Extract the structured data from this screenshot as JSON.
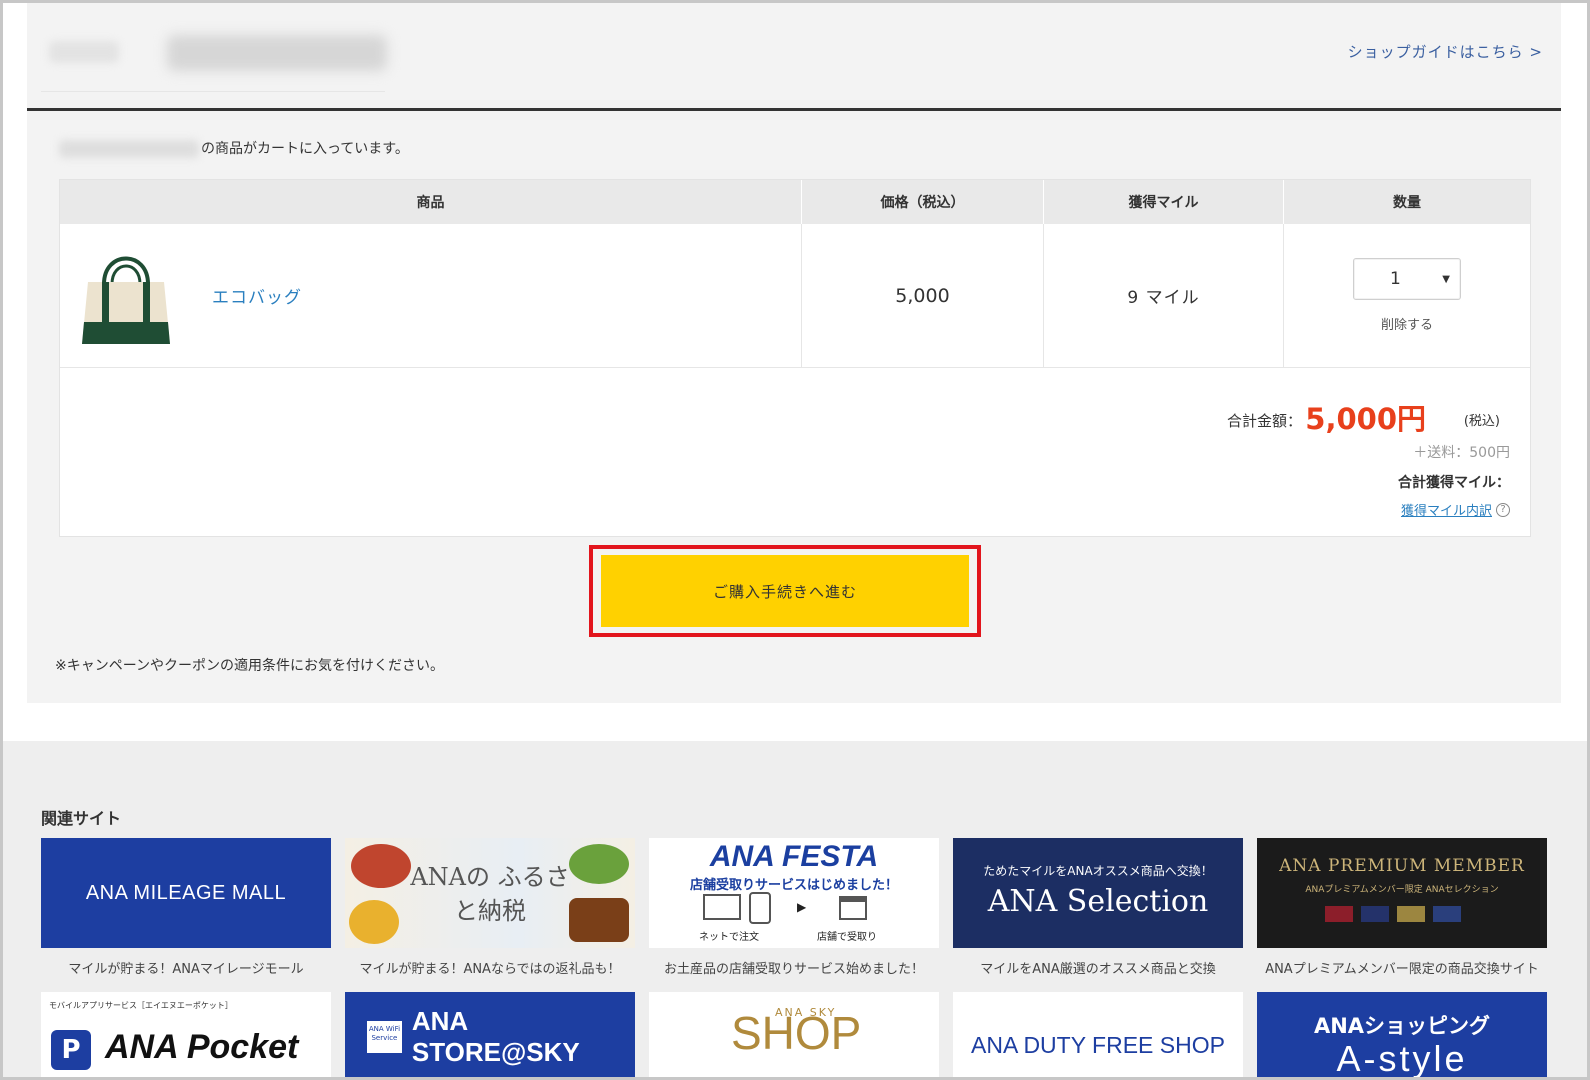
{
  "header": {
    "shop_guide_link": "ショップガイドはこちら >"
  },
  "cart": {
    "message_suffix": "の商品がカートに入っています。",
    "columns": [
      "商品",
      "価格（税込）",
      "獲得マイル",
      "数量"
    ],
    "items": [
      {
        "name": "エコバッグ",
        "price": "5,000",
        "miles": "9 マイル",
        "quantity": "1",
        "delete_label": "削除する"
      }
    ],
    "totals": {
      "label": "合計金額：",
      "value": "5,000円",
      "tax": "(税込)",
      "shipping": "＋送料：500円",
      "miles_label": "合計獲得マイル：",
      "miles_detail": "獲得マイル内訳"
    },
    "checkout_button": "ご購入手続きへ進む",
    "note": "※キャンペーンやクーポンの適用条件にお気を付けください。"
  },
  "related": {
    "title": "関連サイト",
    "sites": [
      {
        "banner": "ANA MILEAGE MALL",
        "caption": "マイルが貯まる！ANAマイレージモール"
      },
      {
        "banner": "ANAの ふるさと納税",
        "caption": "マイルが貯まる！ANAならではの返礼品も！"
      },
      {
        "banner": "ANA FESTA",
        "banner_sub": "店舗受取りサービスはじめました！",
        "banner_l1": "ネットで注文",
        "banner_l2": "店舗で受取り",
        "caption": "お土産品の店舗受取りサービス始めました！"
      },
      {
        "banner": "ANA Selection",
        "banner_sub": "ためたマイルをANAオススメ商品へ交換！",
        "caption": "マイルをANA厳選のオススメ商品と交換"
      },
      {
        "banner": "ANA PREMIUM MEMBER",
        "banner_sub": "ANAプレミアムメンバー限定 ANAセレクション",
        "caption": "ANAプレミアムメンバー限定の商品交換サイト"
      },
      {
        "banner": "ANA Pocket",
        "banner_sub": "モバイルアプリサービス［エイエヌエーポケット］"
      },
      {
        "banner": "ANA STORE@SKY",
        "banner_sub": "ANA WiFi Service"
      },
      {
        "banner": "SHOP",
        "banner_sub": "ANA SKY"
      },
      {
        "banner": "ANA DUTY FREE SHOP"
      },
      {
        "banner": "ANAショッピング",
        "banner_sub": "A-style"
      }
    ]
  },
  "colors": {
    "accent_yellow": "#ffd100",
    "highlight_red": "#e2151d",
    "price_red": "#e8401c",
    "link_blue": "#2a7fbf",
    "ana_blue": "#1d3ea1"
  }
}
